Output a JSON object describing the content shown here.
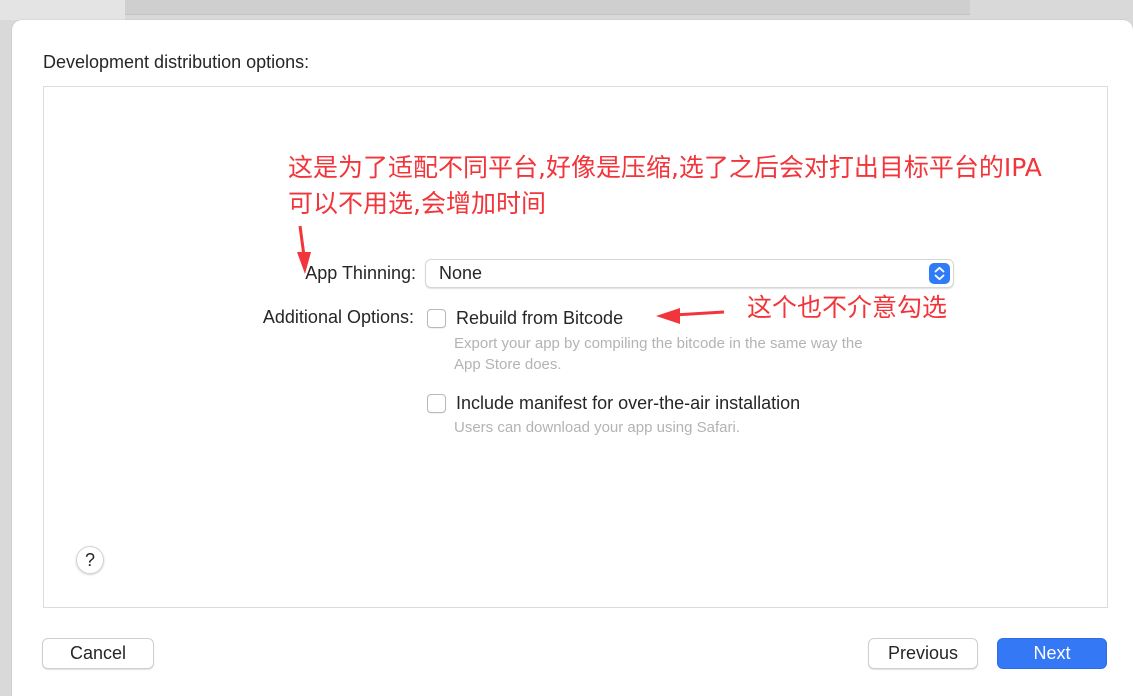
{
  "dialog": {
    "heading": "Development distribution options:",
    "app_thinning": {
      "label": "App Thinning:",
      "value": "None",
      "stepper_icon": "up-down-chevron-icon"
    },
    "additional_options": {
      "label": "Additional Options:",
      "options": [
        {
          "title": "Rebuild from Bitcode",
          "checked": false,
          "description_lines": [
            "Export your app by compiling the bitcode in the same way the",
            "App Store does."
          ]
        },
        {
          "title": "Include manifest for over-the-air installation",
          "checked": false,
          "description_lines": [
            "Users can download your app using Safari."
          ]
        }
      ]
    },
    "help_label": "?",
    "buttons": {
      "cancel": "Cancel",
      "previous": "Previous",
      "next": "Next"
    }
  },
  "annotations": {
    "note_top_line1": "这是为了适配不同平台,好像是压缩,选了之后会对打出目标平台的IPA",
    "note_top_line2": "可以不用选,会增加时间",
    "note_right": "这个也不介意勾选",
    "color": "#f2353a"
  },
  "colors": {
    "accent": "#3478f6",
    "text": "#262626",
    "secondary_text": "#b3b3b3"
  }
}
